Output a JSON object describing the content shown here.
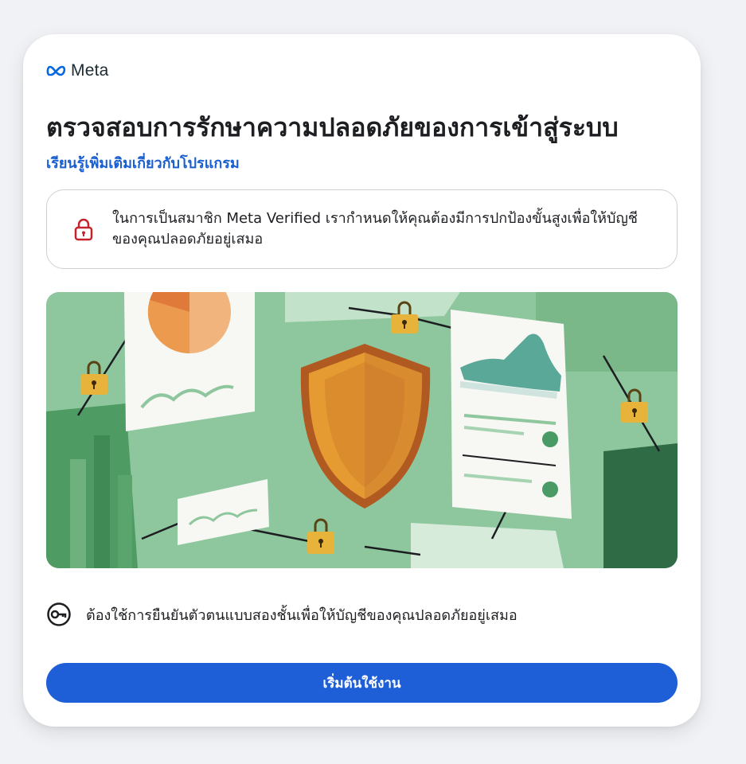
{
  "brand": {
    "name": "Meta",
    "logo_icon": "meta-infinity-logo",
    "color": "#0668e1"
  },
  "header": {
    "title": "ตรวจสอบการรักษาความปลอดภัยของการเข้าสู่ระบบ",
    "learn_more": "เรียนรู้เพิ่มเติมเกี่ยวกับโปรแกรม"
  },
  "notice": {
    "icon": "lock-icon",
    "text": "ในการเป็นสมาชิก Meta Verified เรากำหนดให้คุณต้องมีการปกป้องขั้นสูงเพื่อให้บัญชีของคุณปลอดภัยอยู่เสมอ",
    "icon_color": "#c4232b"
  },
  "illustration": {
    "description_icon": "security-shield-illustration"
  },
  "requirement": {
    "icon": "key-icon",
    "text": "ต้องใช้การยืนยันตัวตนแบบสองชั้นเพื่อให้บัญชีของคุณปลอดภัยอยู่เสมอ"
  },
  "cta": {
    "label": "เริ่มต้นใช้งาน",
    "color": "#1e5fd8"
  }
}
